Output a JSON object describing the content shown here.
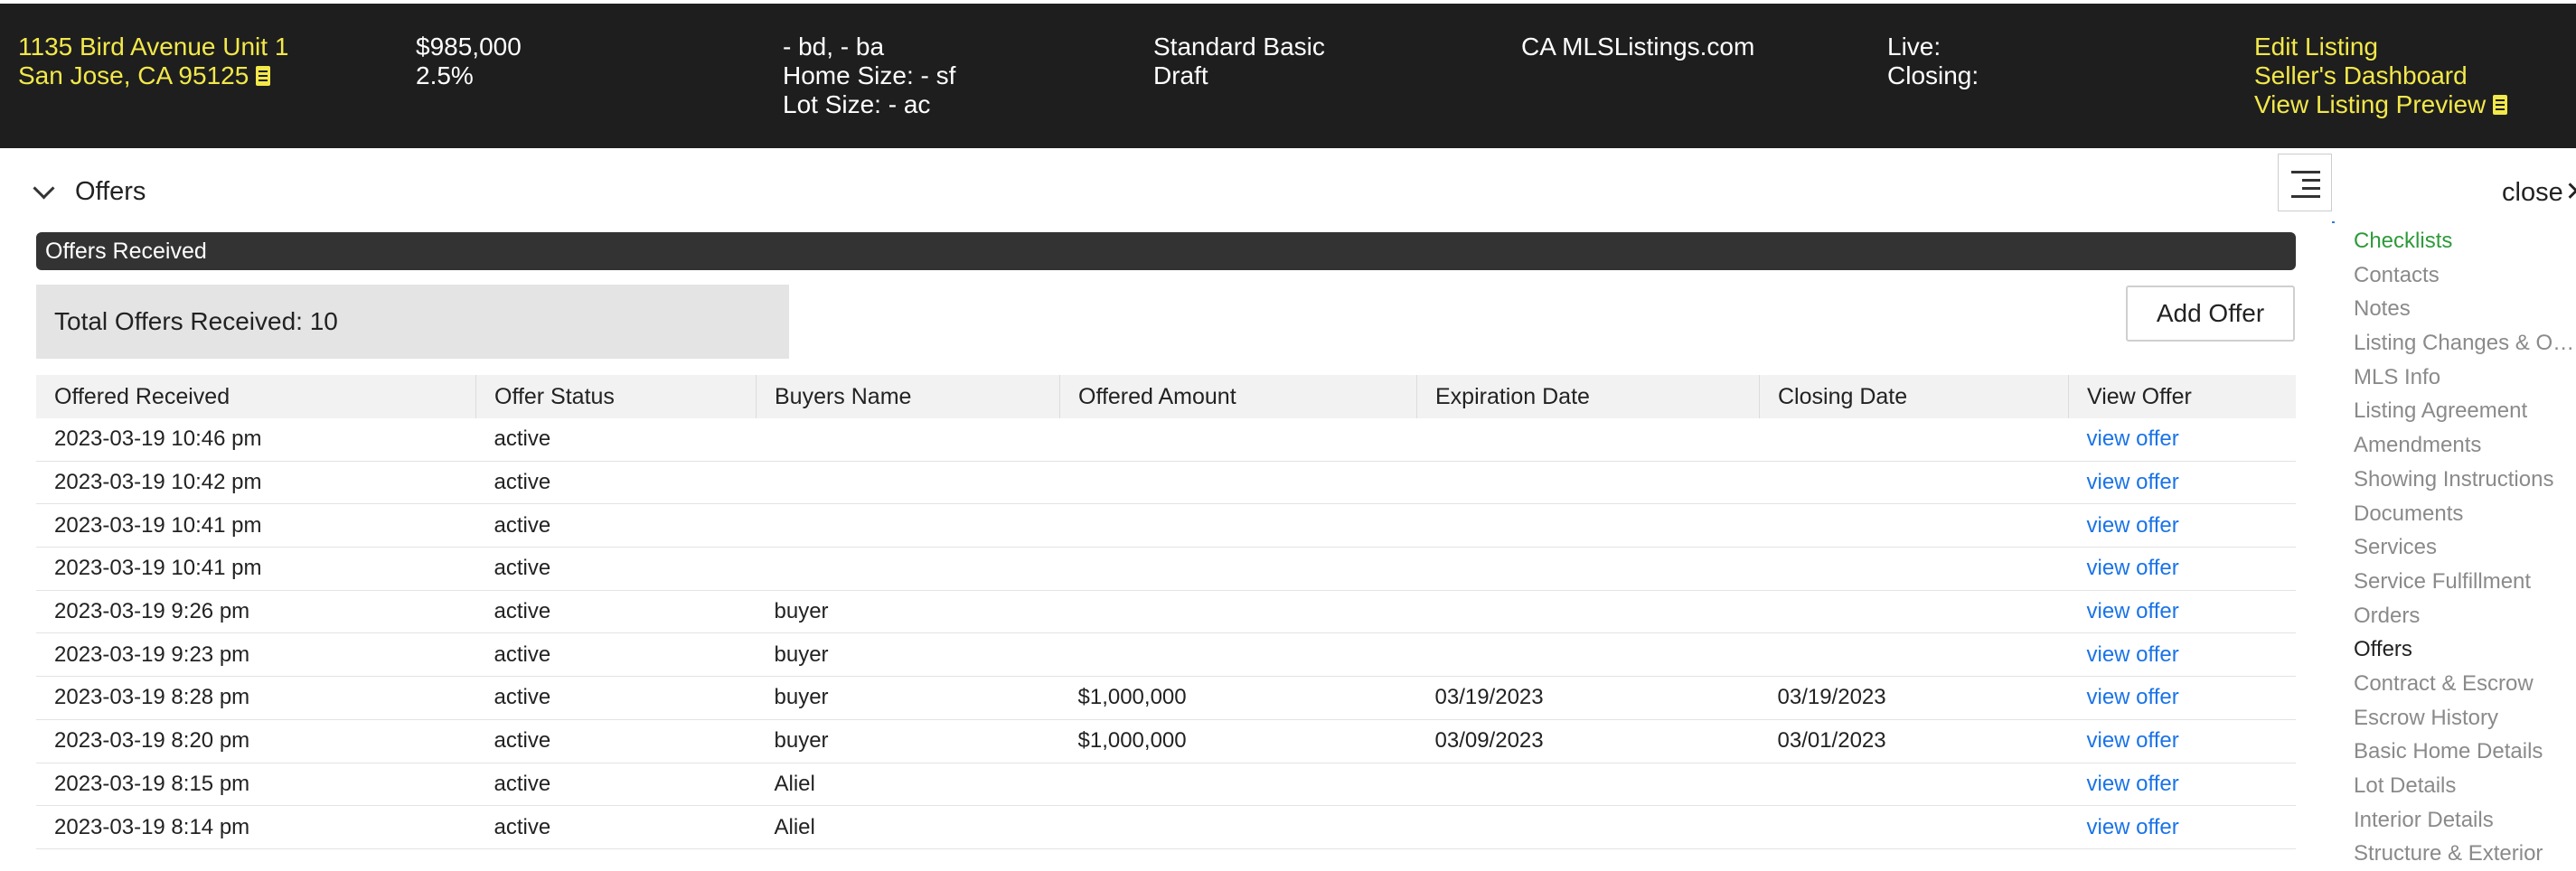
{
  "header": {
    "address_line1": "1135 Bird Avenue Unit 1",
    "address_line2": "San Jose, CA 95125",
    "price": "$985,000",
    "commission": "2.5%",
    "beds_baths": "- bd, - ba",
    "home_size": "Home Size: - sf",
    "lot_size": "Lot Size: - ac",
    "plan": "Standard Basic",
    "status": "Draft",
    "mls": "CA MLSListings.com",
    "live_label": "Live:",
    "closing_label": "Closing:",
    "links": {
      "edit_listing": "Edit Listing",
      "sellers_dashboard": "Seller's Dashboard",
      "view_listing_preview": "View Listing Preview"
    }
  },
  "offers_section": {
    "title": "Offers",
    "bar_label": "Offers Received",
    "total_label": "Total Offers Received: 10",
    "add_offer_label": "Add Offer",
    "columns": [
      "Offered Received",
      "Offer Status",
      "Buyers Name",
      "Offered Amount",
      "Expiration Date",
      "Closing Date",
      "View Offer"
    ],
    "rows": [
      {
        "received": "2023-03-19 10:46 pm",
        "status": "active",
        "buyer": "",
        "amount": "",
        "expiration": "",
        "closing": "",
        "link": "view offer"
      },
      {
        "received": "2023-03-19 10:42 pm",
        "status": "active",
        "buyer": "",
        "amount": "",
        "expiration": "",
        "closing": "",
        "link": "view offer"
      },
      {
        "received": "2023-03-19 10:41 pm",
        "status": "active",
        "buyer": "",
        "amount": "",
        "expiration": "",
        "closing": "",
        "link": "view offer"
      },
      {
        "received": "2023-03-19 10:41 pm",
        "status": "active",
        "buyer": "",
        "amount": "",
        "expiration": "",
        "closing": "",
        "link": "view offer"
      },
      {
        "received": "2023-03-19 9:26 pm",
        "status": "active",
        "buyer": "buyer",
        "amount": "",
        "expiration": "",
        "closing": "",
        "link": "view offer"
      },
      {
        "received": "2023-03-19 9:23 pm",
        "status": "active",
        "buyer": "buyer",
        "amount": "",
        "expiration": "",
        "closing": "",
        "link": "view offer"
      },
      {
        "received": "2023-03-19 8:28 pm",
        "status": "active",
        "buyer": "buyer",
        "amount": "$1,000,000",
        "expiration": "03/19/2023",
        "closing": "03/19/2023",
        "link": "view offer"
      },
      {
        "received": "2023-03-19 8:20 pm",
        "status": "active",
        "buyer": "buyer",
        "amount": "$1,000,000",
        "expiration": "03/09/2023",
        "closing": "03/01/2023",
        "link": "view offer"
      },
      {
        "received": "2023-03-19 8:15 pm",
        "status": "active",
        "buyer": "Aliel",
        "amount": "",
        "expiration": "",
        "closing": "",
        "link": "view offer"
      },
      {
        "received": "2023-03-19 8:14 pm",
        "status": "active",
        "buyer": "Aliel",
        "amount": "",
        "expiration": "",
        "closing": "",
        "link": "view offer"
      }
    ]
  },
  "side_panel": {
    "close_label": "close",
    "close_icon": "close-icon",
    "toggle_icon": "indent-menu-icon",
    "items": [
      "Checklists",
      "Contacts",
      "Notes",
      "Listing Changes & Offers",
      "MLS Info",
      "Listing Agreement",
      "Amendments",
      "Showing Instructions",
      "Documents",
      "Services",
      "Service Fulfillment",
      "Orders",
      "Offers",
      "Contract & Escrow",
      "Escrow History",
      "Basic Home Details",
      "Lot Details",
      "Interior Details",
      "Structure & Exterior"
    ],
    "current": "Offers"
  },
  "colors": {
    "header_bg": "#1e1e1e",
    "header_link": "#f2e84a",
    "link_blue": "#1a73e8",
    "checklists_green": "#2e9a3a",
    "nav_indicator": "#2f7bd8"
  }
}
